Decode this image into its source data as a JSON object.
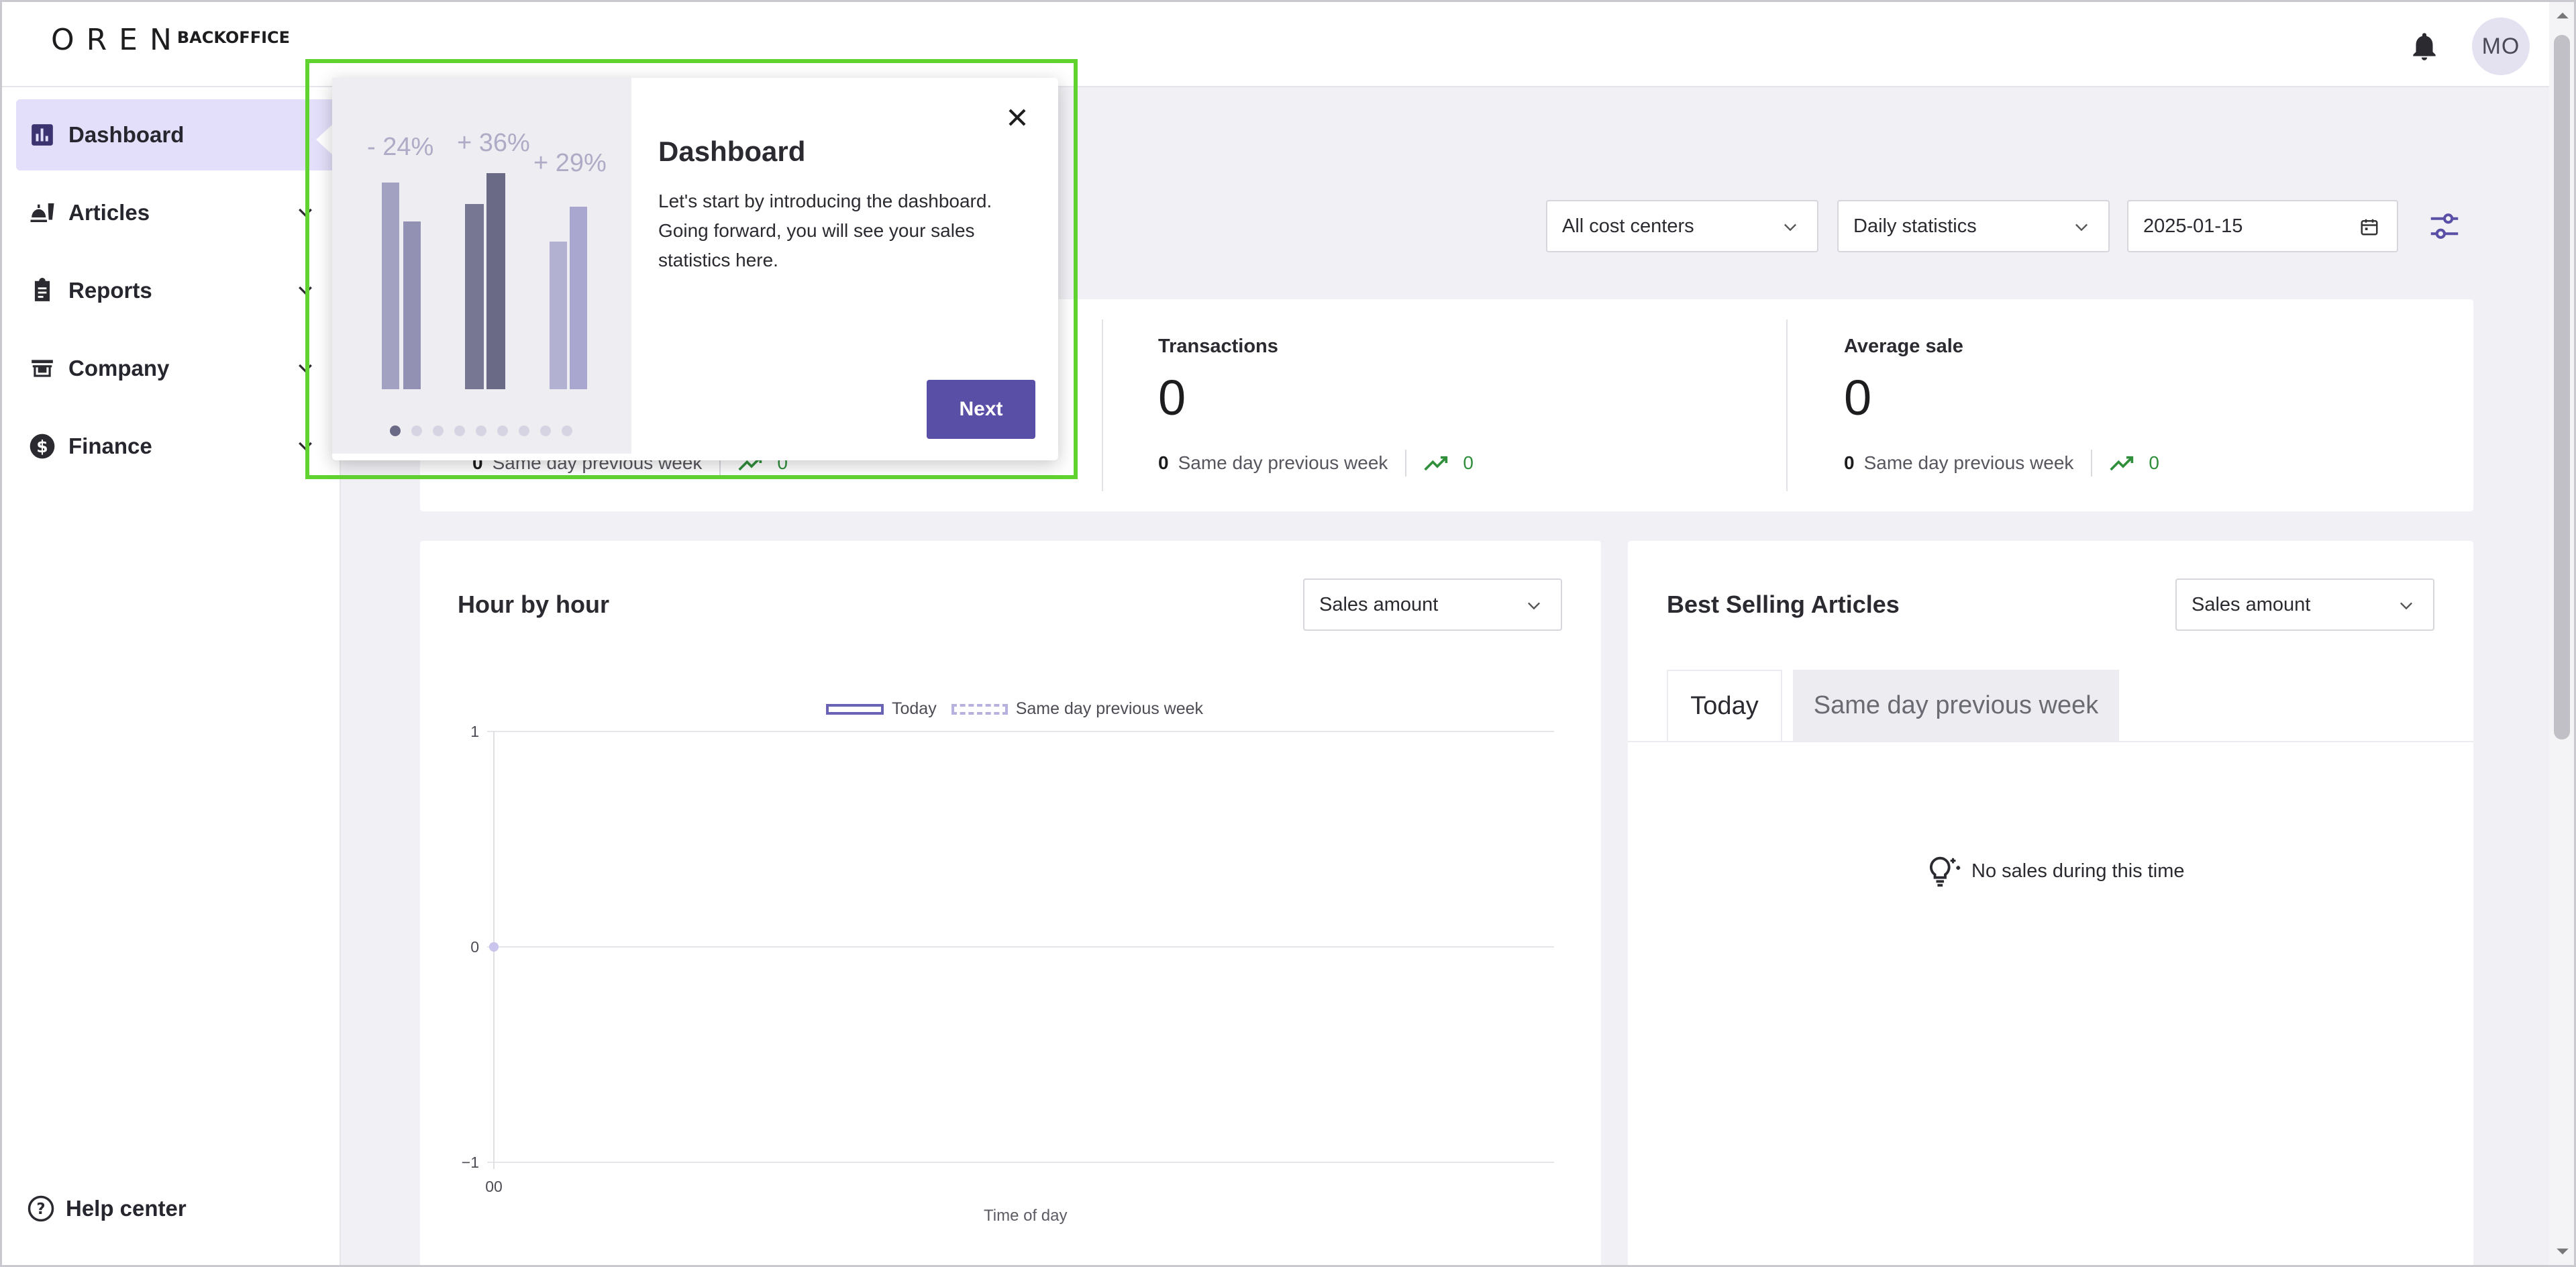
{
  "header": {
    "logo_mark": "O R E N",
    "logo_text": "BACKOFFICE",
    "avatar_initials": "MO"
  },
  "sidebar": {
    "items": [
      {
        "label": "Dashboard",
        "icon": "bar-chart-icon",
        "active": true
      },
      {
        "label": "Articles",
        "icon": "food-icon"
      },
      {
        "label": "Reports",
        "icon": "clipboard-icon"
      },
      {
        "label": "Company",
        "icon": "store-icon"
      },
      {
        "label": "Finance",
        "icon": "dollar-icon"
      }
    ],
    "help_label": "Help center"
  },
  "filters": {
    "cost_center": "All cost centers",
    "statistics": "Daily statistics",
    "date": "2025-01-15"
  },
  "stats": [
    {
      "title": "",
      "value": "",
      "prev_value": "0",
      "prev_label": "Same day previous week",
      "trend": "0"
    },
    {
      "title": "Transactions",
      "value": "0",
      "prev_value": "0",
      "prev_label": "Same day previous week",
      "trend": "0"
    },
    {
      "title": "Average sale",
      "value": "0",
      "prev_value": "0",
      "prev_label": "Same day previous week",
      "trend": "0"
    }
  ],
  "hourly": {
    "title": "Hour by hour",
    "metric": "Sales amount",
    "legend_today": "Today",
    "legend_prev": "Same day previous week",
    "xlabel": "Time of day"
  },
  "chart_data": {
    "type": "line",
    "x": [
      "00"
    ],
    "series": [
      {
        "name": "Today",
        "values": [
          0
        ]
      },
      {
        "name": "Same day previous week",
        "values": [
          0
        ]
      }
    ],
    "xlabel": "Time of day",
    "ylabel": "",
    "ylim": [
      -1,
      1
    ],
    "yticks": [
      "1",
      "0",
      "−1"
    ],
    "grid": true,
    "legend": "top-center"
  },
  "best_selling": {
    "title": "Best Selling Articles",
    "metric": "Sales amount",
    "tabs": [
      "Today",
      "Same day previous week"
    ],
    "empty_message": "No sales during this time"
  },
  "tour": {
    "title": "Dashboard",
    "body": "Let's start by introducing the dashboard. Going forward, you will see your sales statistics here.",
    "next_label": "Next",
    "illustration_labels": [
      "- 24%",
      "+ 36%",
      "+ 29%"
    ],
    "step": 1,
    "total_steps": 9
  },
  "colors": {
    "accent": "#5a4fa6",
    "active_nav": "#e3dffa",
    "highlight_outline": "#61d331",
    "trend_up": "#2f8f3b"
  }
}
